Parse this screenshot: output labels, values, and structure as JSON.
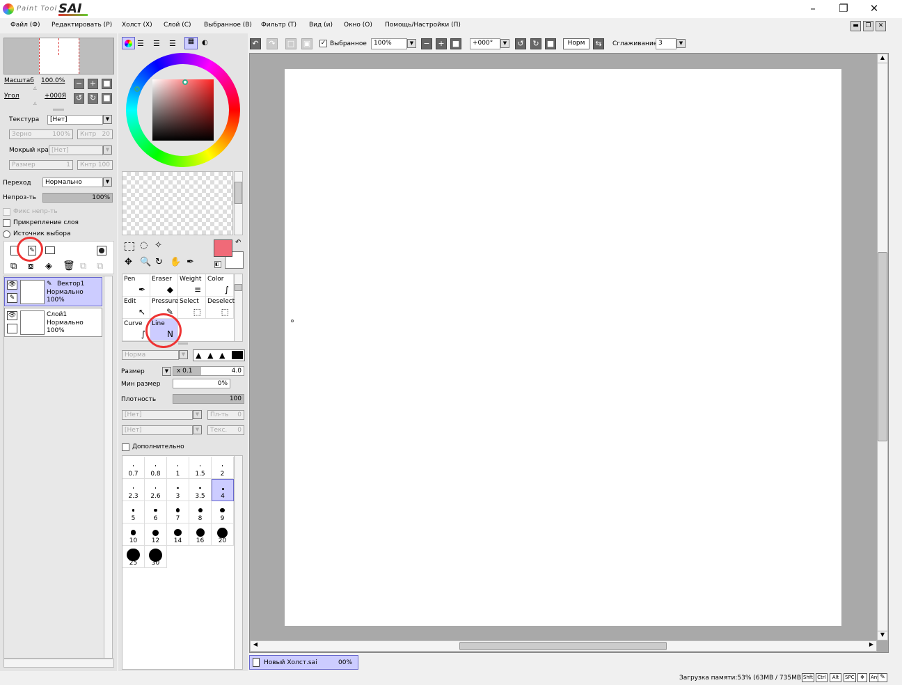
{
  "app": {
    "logo_small": "Paint Tool",
    "logo_big": "SAI"
  },
  "window": {
    "minimize": "–",
    "restore": "❐",
    "close": "✕"
  },
  "menu": [
    "Файл (Ф)",
    "Редактировать (Р)",
    "Холст (Х)",
    "Слой (С)",
    "Выбранное (В)",
    "Фильтр (Т)",
    "Вид (и)",
    "Окно (О)",
    "Помощь/Настройки (П)"
  ],
  "nav": {
    "zoom_label": "Масштаб",
    "zoom_value": "100.0%",
    "angle_label": "Угол",
    "angle_value": "+000Я"
  },
  "texture": {
    "label": "Текстура",
    "value": "[Нет]",
    "grain_label": "Зерно",
    "grain_value": "100%",
    "contrast_label": "Кнтр",
    "contrast_value": "20",
    "wet_label": "Мокрый край",
    "wet_value": "[Нет]",
    "size_label": "Размер",
    "size_value": "1",
    "contrast2_label": "Кнтр",
    "contrast2_value": "100"
  },
  "blend": {
    "label": "Переход",
    "value": "Нормально",
    "opacity_label": "Непроз-ть",
    "opacity_value": "100%",
    "opacity_fraction": 1.0
  },
  "checks": {
    "preserve_opacity": "Фикс непр-ть",
    "clipping": "Прикрепление слоя",
    "selection_source": "Источник выбора"
  },
  "layers": [
    {
      "name": "Вектор1",
      "mode": "Нормально",
      "opacity": "100%",
      "selected": true,
      "vector": true
    },
    {
      "name": "Слой1",
      "mode": "Нормально",
      "opacity": "100%",
      "selected": false,
      "vector": false
    }
  ],
  "colors": {
    "primary": "#f06a78",
    "secondary": "#ffffff"
  },
  "tools": [
    {
      "name": "Pen",
      "row": 0,
      "col": 0
    },
    {
      "name": "Eraser",
      "row": 0,
      "col": 1
    },
    {
      "name": "Weight",
      "row": 0,
      "col": 2
    },
    {
      "name": "Color",
      "row": 0,
      "col": 3
    },
    {
      "name": "Edit",
      "row": 1,
      "col": 0
    },
    {
      "name": "Pressure",
      "row": 1,
      "col": 1
    },
    {
      "name": "Select",
      "row": 1,
      "col": 2
    },
    {
      "name": "Deselect",
      "row": 1,
      "col": 3
    },
    {
      "name": "Curve",
      "row": 2,
      "col": 0
    },
    {
      "name": "Line",
      "row": 2,
      "col": 1
    }
  ],
  "brush": {
    "mode": "Норма",
    "size_label": "Размер",
    "size_mult": "x 0.1",
    "size_value": "4.0",
    "min_label": "Мин размер",
    "min_value": "0%",
    "density_label": "Плотность",
    "density_value": "100",
    "shape1": "[Нет]",
    "shape1_label": "Пл-ть",
    "shape1_value": "0",
    "shape2": "[Нет]",
    "shape2_label": "Текс.",
    "shape2_value": "0",
    "advanced": "Дополнительно"
  },
  "brush_sizes": [
    "0.7",
    "0.8",
    "1",
    "1.5",
    "2",
    "2.3",
    "2.6",
    "3",
    "3.5",
    "4",
    "5",
    "6",
    "7",
    "8",
    "9",
    "10",
    "12",
    "14",
    "16",
    "20",
    "25",
    "30"
  ],
  "brush_selected": "4",
  "toolbar": {
    "selection_label": "Выбранное",
    "zoom": "100%",
    "angle": "+000°",
    "mode": "Норм",
    "stabilizer_label": "Сглаживание",
    "stabilizer_value": "3"
  },
  "doc_tab": {
    "name": "Новый Холст.sai",
    "progress": "00%"
  },
  "status": {
    "memory": "Загрузка памяти:53% (63MB / 735MB)",
    "keys": [
      "Shft",
      "Ctrl",
      "Alt",
      "SPC",
      "✥",
      "Any"
    ]
  }
}
